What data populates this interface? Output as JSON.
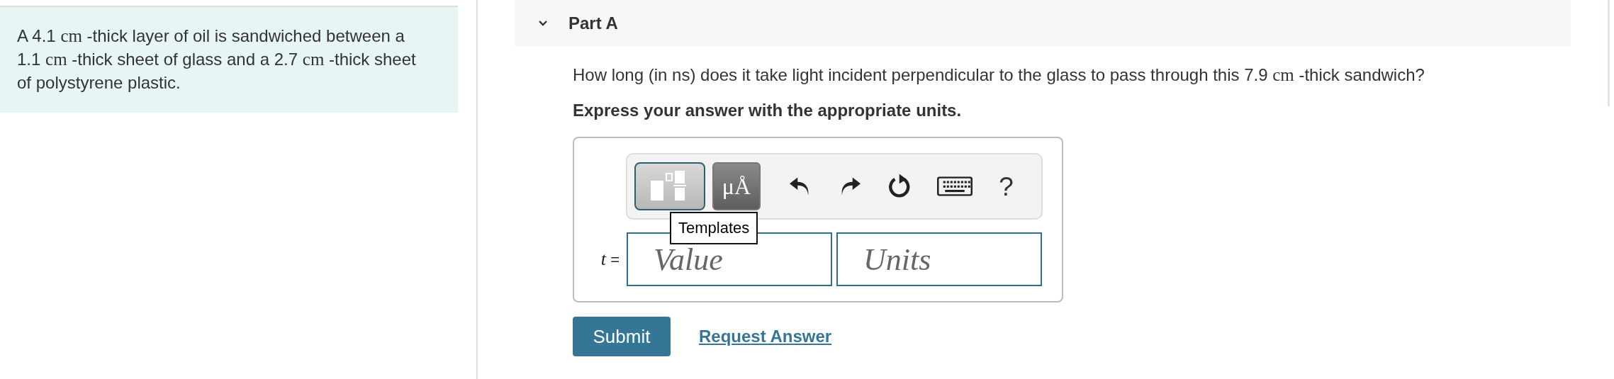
{
  "problem": {
    "segments": [
      {
        "kind": "text",
        "text": "A 4.1 "
      },
      {
        "kind": "math",
        "text": "cm"
      },
      {
        "kind": "text",
        "text": " -thick layer of oil is sandwiched between a 1.1 "
      },
      {
        "kind": "math",
        "text": "cm"
      },
      {
        "kind": "text",
        "text": " -thick sheet of glass and a 2.7 "
      },
      {
        "kind": "math",
        "text": "cm"
      },
      {
        "kind": "text",
        "text": " -thick sheet of polystyrene plastic."
      }
    ]
  },
  "part": {
    "title": "Part A",
    "expanded": true
  },
  "question": {
    "segments": [
      {
        "kind": "text",
        "text": "How long (in ns) does it take light incident perpendicular to the glass to pass through this 7.9 "
      },
      {
        "kind": "math",
        "text": "cm"
      },
      {
        "kind": "text",
        "text": " -thick sandwich?"
      }
    ]
  },
  "instruction": "Express your answer with the appropriate units.",
  "toolbar": [
    {
      "kind": "templates",
      "selected": true
    },
    {
      "kind": "units",
      "label": "μÅ",
      "selected": false
    },
    {
      "kind": "undo"
    },
    {
      "kind": "redo"
    },
    {
      "kind": "reset"
    },
    {
      "kind": "keyboard"
    },
    {
      "kind": "help",
      "label": "?"
    }
  ],
  "tooltip": "Templates",
  "answer": {
    "variable": "t",
    "equals": "=",
    "value_placeholder": "Value",
    "units_placeholder": "Units"
  },
  "buttons": {
    "submit": "Submit",
    "request": "Request Answer"
  }
}
